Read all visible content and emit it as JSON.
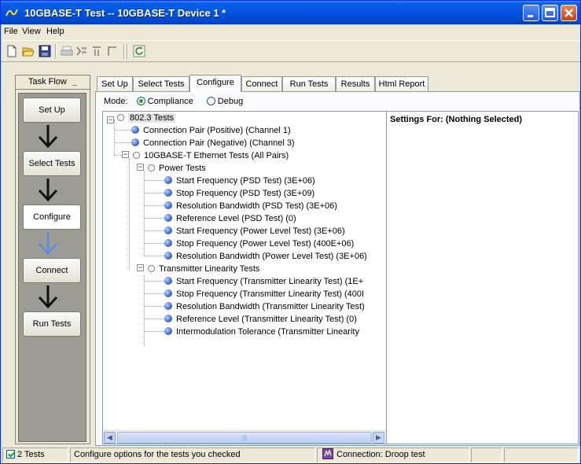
{
  "window": {
    "title": "10GBASE-T Test -- 10GBASE-T Device 1 *",
    "controls": [
      "minimize-icon",
      "maximize-icon",
      "close-icon"
    ]
  },
  "menu": {
    "items": [
      "File",
      "View",
      "Help"
    ]
  },
  "toolbar": {
    "icons": [
      "new-icon",
      "open-icon",
      "save-icon",
      "print-icon",
      "run-checked-icon",
      "run-all-icon",
      "stop-icon",
      "refresh-icon"
    ]
  },
  "taskflow": {
    "header": "Task Flow",
    "collapse": "_",
    "steps": [
      "Set Up",
      "Select Tests",
      "Configure",
      "Connect",
      "Run Tests"
    ],
    "active_step": "Configure"
  },
  "tabs": {
    "items": [
      "Set Up",
      "Select Tests",
      "Configure",
      "Connect",
      "Run Tests",
      "Results",
      "Html Report"
    ],
    "active": "Configure"
  },
  "mode": {
    "label": "Mode:",
    "options": [
      "Compliance",
      "Debug"
    ],
    "selected": "Compliance"
  },
  "tree": {
    "root": "802.3 Tests",
    "nodes": [
      "Connection Pair (Positive) (Channel 1)",
      "Connection Pair (Negative) (Channel 3)",
      "10GBASE-T Ethernet Tests (All Pairs)",
      "Power Tests",
      "Start Frequency (PSD Test) (3E+06)",
      "Stop Frequency (PSD Test) (3E+09)",
      "Resolution Bandwidth (PSD Test) (3E+06)",
      "Reference Level (PSD Test) (0)",
      "Start Frequency (Power Level Test) (3E+06)",
      "Stop Frequency (Power Level Test) (400E+06)",
      "Resolution Bandwidth (Power Level Test) (3E+06)",
      "Transmitter Linearity Tests",
      "Start Frequency (Transmitter Linearity Test) (1E+",
      "Stop Frequency (Transmitter Linearity Test) (400I",
      "Resolution Bandwidth (Transmitter Linearity Test)",
      "Reference Level (Transmitter Linearity Test) (0)",
      "Intermodulation Tolerance (Transmitter Linearity"
    ]
  },
  "settings": {
    "header": "Settings For: (Nothing Selected)"
  },
  "status": {
    "tests": "2 Tests",
    "message": "Configure options for the tests you checked",
    "connection": "Connection: Droop test"
  }
}
